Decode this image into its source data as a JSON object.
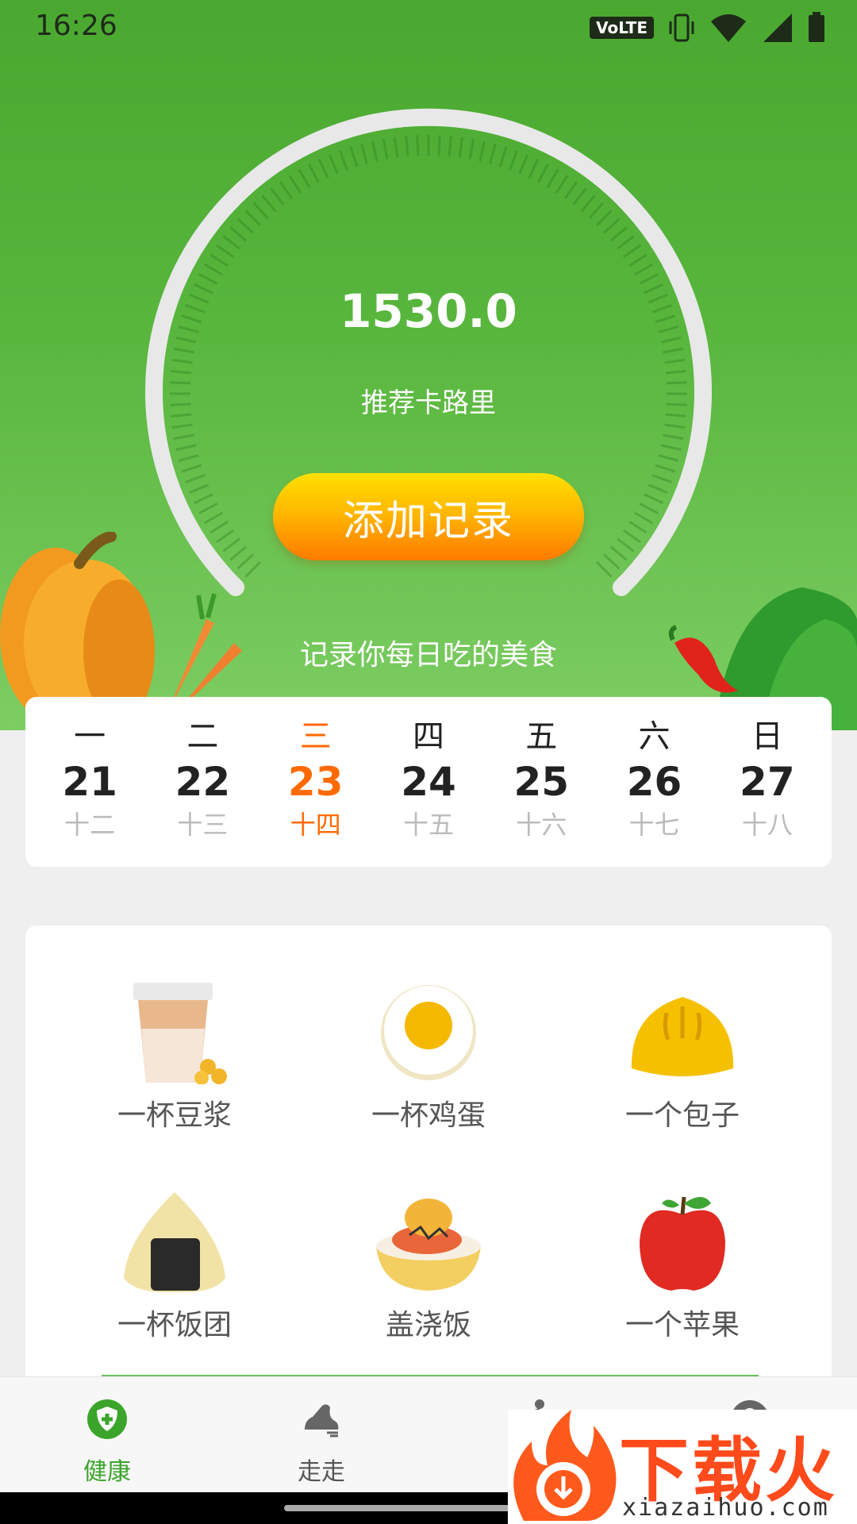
{
  "status_bar": {
    "time": "16:26",
    "volte": "VoLTE",
    "icons": [
      "vibrate-icon",
      "wifi-icon",
      "signal-icon",
      "battery-icon"
    ]
  },
  "hero": {
    "calorie_value": "1530.0",
    "calorie_label": "推荐卡路里",
    "add_button": "添加记录",
    "subtitle": "记录你每日吃的美食"
  },
  "calendar": {
    "active_index": 2,
    "days": [
      {
        "weekday": "一",
        "date": "21",
        "lunar": "十二"
      },
      {
        "weekday": "二",
        "date": "22",
        "lunar": "十三"
      },
      {
        "weekday": "三",
        "date": "23",
        "lunar": "十四"
      },
      {
        "weekday": "四",
        "date": "24",
        "lunar": "十五"
      },
      {
        "weekday": "五",
        "date": "25",
        "lunar": "十六"
      },
      {
        "weekday": "六",
        "date": "26",
        "lunar": "十七"
      },
      {
        "weekday": "日",
        "date": "27",
        "lunar": "十八"
      }
    ]
  },
  "foods": [
    {
      "label": "一杯豆浆",
      "icon": "soymilk-icon"
    },
    {
      "label": "一杯鸡蛋",
      "icon": "egg-icon"
    },
    {
      "label": "一个包子",
      "icon": "bun-icon"
    },
    {
      "label": "一杯饭团",
      "icon": "rice-ball-icon"
    },
    {
      "label": "盖浇饭",
      "icon": "rice-bowl-icon"
    },
    {
      "label": "一个苹果",
      "icon": "apple-icon"
    }
  ],
  "nav": [
    {
      "label": "健康",
      "icon": "health-shield-icon",
      "active": true
    },
    {
      "label": "走走",
      "icon": "shoe-icon",
      "active": false
    },
    {
      "label": "",
      "icon": "running-icon",
      "active": false
    },
    {
      "label": "",
      "icon": "profile-icon",
      "active": false
    }
  ],
  "watermark": {
    "title": "下载火",
    "url": "xiazaihuo.com"
  },
  "colors": {
    "accent_orange": "#ff6a00",
    "nav_active_green": "#3aa52a",
    "hero_green": "#58b63d"
  }
}
